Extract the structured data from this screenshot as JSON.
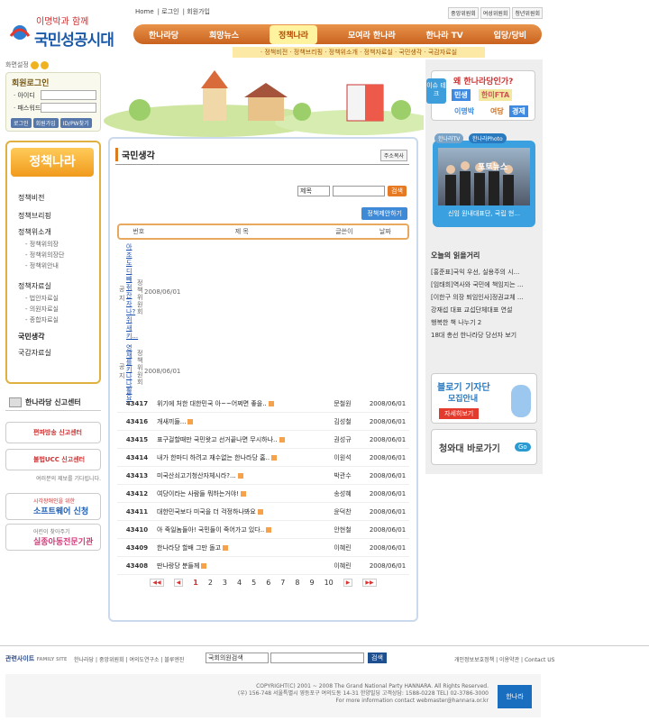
{
  "header": {
    "slogan": "이명박과 함께",
    "logo_text": "국민성공시대",
    "top_links": [
      "Home",
      "로그인",
      "회원가입"
    ],
    "right_links": [
      "중앙위원회",
      "여성위원회",
      "청년위원회"
    ],
    "nav": [
      "한나라당",
      "희망뉴스",
      "정책나라",
      "모여라 한나라",
      "한나라 TV",
      "입당/당비"
    ],
    "subnav": "· 정책비전 · 정책브리핑 · 정책위소개 · 정책자료실 · 국민생각 · 국감자료실"
  },
  "left": {
    "mode_label": "화면설정",
    "login_title": "회원로그인",
    "id_label": "· 아이디",
    "pw_label": "· 패스워드",
    "btns": [
      "로그인",
      "회원가입",
      "ID/PW찾기"
    ],
    "side_title": "정책나라",
    "side_items": [
      "정책비전",
      "정책브리핑",
      "정책위소개",
      "정책자료실",
      "국민생각",
      "국감자료실"
    ],
    "side_sub1": [
      "- 정책위의장",
      "- 정책위의장단",
      "- 정책위안내"
    ],
    "side_sub2": [
      "- 법안자료실",
      "- 의원자료실",
      "- 종합자료실"
    ],
    "report_title": "한나라당 신고센터",
    "report1": "편파방송 신고센터",
    "report2": "불법UCC 신고센터",
    "report_note": "여러분의 제보를 기다립니다.",
    "banner1_small": "시각장애인을 위한",
    "banner1": "소프트웨어 신청",
    "banner2_small": "어린이 찾아주기",
    "banner2": "실종아동전문기관"
  },
  "content": {
    "title": "국민생각",
    "addr_btn": "주소복사",
    "search_select": "제목",
    "search_btn": "검색",
    "propose_btn": "정책제안하기",
    "headers": [
      "번호",
      "제  목",
      "글쓴이",
      "날짜"
    ],
    "notices": [
      {
        "label": "공지",
        "title": "아조도디빼젂잔자나?쥐새키...",
        "writer": "정책위원회",
        "date": "2008/06/01"
      },
      {
        "label": "공지",
        "title": "영재를키나나뿔요",
        "writer": "정책위원회",
        "date": "2008/06/01"
      }
    ],
    "rows": [
      {
        "num": "43417",
        "title": "위기에 처한 대한민국 아~~어쩌면 좋을..",
        "writer": "문철원",
        "date": "2008/06/01"
      },
      {
        "num": "43416",
        "title": "개새끼들...",
        "writer": "김성철",
        "date": "2008/06/01"
      },
      {
        "num": "43415",
        "title": "표구걸할때만 국민왓고 선거끝나면 무시하나..",
        "writer": "권성규",
        "date": "2008/06/01"
      },
      {
        "num": "43414",
        "title": "내가 한마디 하려고 재수없는 한나라당 홈..",
        "writer": "이원석",
        "date": "2008/06/01"
      },
      {
        "num": "43413",
        "title": "미국산쇠고기청산자체시라?...",
        "writer": "박관수",
        "date": "2008/06/01"
      },
      {
        "num": "43412",
        "title": "여당이라는 사람들 뭐하는거야!",
        "writer": "송성혜",
        "date": "2008/06/01"
      },
      {
        "num": "43411",
        "title": "대한민국보다 미국을 더 걱정하나봐요",
        "writer": "윤덕찬",
        "date": "2008/06/01"
      },
      {
        "num": "43410",
        "title": "아 죽일놈들아! 국민들이 죽어가고 있다..",
        "writer": "안현철",
        "date": "2008/06/01"
      },
      {
        "num": "43409",
        "title": "한나라당 할배 그만 돌고",
        "writer": "이혜린",
        "date": "2008/06/01"
      },
      {
        "num": "43408",
        "title": "딴나랑당 분들께",
        "writer": "이혜린",
        "date": "2008/06/01"
      }
    ],
    "pages": [
      "1",
      "2",
      "3",
      "4",
      "5",
      "6",
      "7",
      "8",
      "9",
      "10"
    ]
  },
  "right": {
    "issue_tag": "이슈 테크",
    "issue_title": "왜 한나라당인가?",
    "tags": [
      "민생",
      "한미FTA",
      "이명박",
      "여당",
      "경제"
    ],
    "tv_tab1": "한나라TV",
    "tv_tab2": "한나라Photo",
    "tv_news": "포토뉴스",
    "tv_caption": "신임 원내대표단, 국립 현...",
    "read_title": "오늘의 읽을거리",
    "read_items": [
      "[홍준표]국익 우선, 실용주의 시...",
      "[임태희]역사와 국민에 책임지는 ...",
      "[이한구 의장 퇴임인사]정권교체 ...",
      "강재섭 대표 교섭단체대표 연설",
      "행복한 책 나누기 2",
      "18대 총선 한나라당 당선자 보기"
    ],
    "blog_title": "블로기 기자단",
    "blog_sub": "모집안내",
    "blog_btn": "자세히보기",
    "cw_title": "청와대 바로가기",
    "cw_go": "Go"
  },
  "footer": {
    "family": "관련사이트",
    "family_en": "FAMILY SITE",
    "links": [
      "한나라당",
      "중앙위원회",
      "여의도연구소",
      "블루엔진"
    ],
    "search_select": "국회의원검색",
    "search_btn": "검색",
    "right_links": [
      "개인정보보호정책",
      "이용약관",
      "Contact US"
    ],
    "copy1": "COPYRIGHT(C) 2001 ~ 2008 The Grand National Party HANNARA. All Rights Reserved.",
    "copy2": "(우) 156-748 서울특별시 영등포구 여의도동 14-31 한양빌딩 고객상담: 1588-0228 TEL) 02-3786-3000",
    "copy3": "For more information contact webmaster@hannara.or.kr",
    "logo": "한나라"
  }
}
